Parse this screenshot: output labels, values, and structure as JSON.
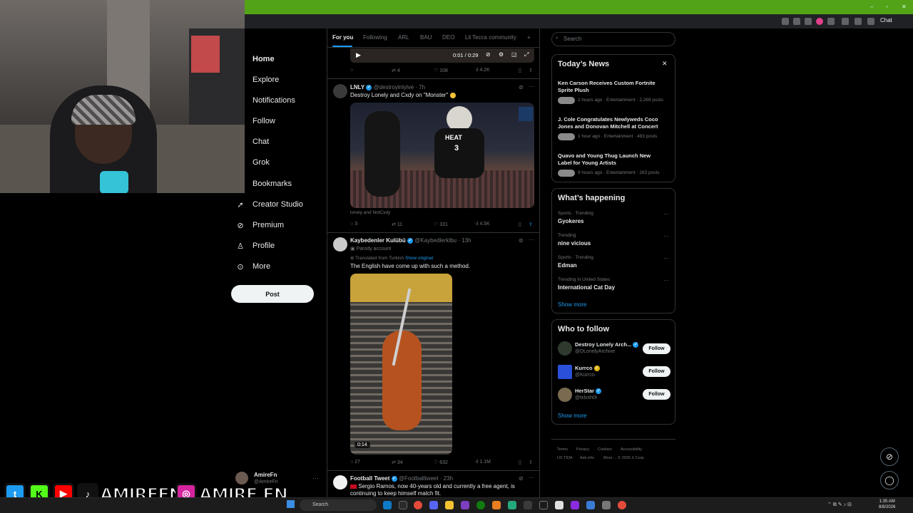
{
  "browser": {
    "chat_label": "Chat"
  },
  "nav": {
    "items": [
      {
        "label": "Home",
        "icon": "home-icon"
      },
      {
        "label": "Explore",
        "icon": "search-icon"
      },
      {
        "label": "Notifications",
        "icon": "bell-icon"
      },
      {
        "label": "Follow",
        "icon": "person-plus-icon"
      },
      {
        "label": "Chat",
        "icon": "chat-icon"
      },
      {
        "label": "Grok",
        "icon": "grok-icon"
      },
      {
        "label": "Bookmarks",
        "icon": "bookmark-icon"
      },
      {
        "label": "Creator Studio",
        "icon": "rocket-icon"
      },
      {
        "label": "Premium",
        "icon": "verified-icon"
      },
      {
        "label": "Profile",
        "icon": "person-icon"
      },
      {
        "label": "More",
        "icon": "more-circle-icon"
      }
    ],
    "post_label": "Post",
    "account": {
      "name": "AmireFn",
      "handle": "@AmireFn"
    }
  },
  "tabs": [
    "For you",
    "Following",
    "ARL",
    "BAU",
    "DEO",
    "Lil Tecca community",
    "+"
  ],
  "video_player": {
    "time": "0:01 / 0:29"
  },
  "tweet0": {
    "replies": "",
    "retweets": "4",
    "likes": "108",
    "views": "4.2K"
  },
  "tweet1": {
    "name": "LNLY",
    "handle": "@destroylnlylve · 7h",
    "text": "Destroy Lonely and Cxdy on \"Monster\"",
    "caption": "lonely and NotCxdy",
    "replies": "3",
    "retweets": "11",
    "likes": "331",
    "views": "4.5K",
    "jersey_team": "HEAT",
    "jersey_number": "3"
  },
  "tweet2": {
    "name": "Kaybedenler Kulübü",
    "handle": "@Kaybedlerklbu · 13h",
    "parody": "Parody account",
    "translated": "Translated from Turkish",
    "show_original": "Show original",
    "text": "The English have come up with such a method.",
    "video_time": "0:14",
    "replies": "27",
    "retweets": "34",
    "likes": "632",
    "views": "1.1M"
  },
  "tweet3": {
    "name": "Football Tweet",
    "handle": "@Footballtweet · 23h",
    "text_line1": "Sergio Ramos, now 40-years old and currently a free agent, is",
    "text_line2": "continuing to keep himself match fit."
  },
  "search": {
    "placeholder": "Search"
  },
  "todays_news": {
    "title": "Today’s News",
    "items": [
      {
        "title": "Ken Carson Receives Custom Fortnite Sprite Plush",
        "meta": "2 hours ago · Entertainment · 2,269 posts"
      },
      {
        "title": "J. Cole Congratulates Newlyweds Coco Jones and Donovan Mitchell at Concert",
        "meta": "1 hour ago · Entertainment · 483 posts"
      },
      {
        "title": "Quavo and Young Thug Launch New Label for Young Artists",
        "meta": "9 hours ago · Entertainment · 283 posts"
      }
    ]
  },
  "whats_happening": {
    "title": "What’s happening",
    "items": [
      {
        "category": "Sports · Trending",
        "name": "Gyokeres"
      },
      {
        "category": "Trending",
        "name": "nine vicious"
      },
      {
        "category": "Sports · Trending",
        "name": "Edman"
      },
      {
        "category": "Trending in United States",
        "name": "International Cat Day"
      }
    ],
    "show_more": "Show more"
  },
  "who_to_follow": {
    "title": "Who to follow",
    "items": [
      {
        "name": "Destroy Lonely Arch...",
        "handle": "@DLonelyArchive",
        "button": "Follow"
      },
      {
        "name": "Kurrco",
        "handle": "@Kurrco",
        "button": "Follow"
      },
      {
        "name": "HerStar",
        "handle": "@txlvsh0t",
        "button": "Follow"
      }
    ],
    "show_more": "Show more"
  },
  "footer": [
    "Terms",
    "Privacy",
    "Cookies",
    "Accessibility",
    "US TIDA",
    "Ads info",
    "More ...",
    "© 2026 X Corp."
  ],
  "overlay": {
    "handle1": "AMIREFN",
    "handle2": "AMIRE.FN"
  },
  "taskbar": {
    "search": "Search",
    "time": "1:35 AM",
    "date": "8/8/2026"
  },
  "colors": {
    "accent": "#1d9bf0",
    "background": "#000000",
    "browser_green": "#52a318"
  }
}
